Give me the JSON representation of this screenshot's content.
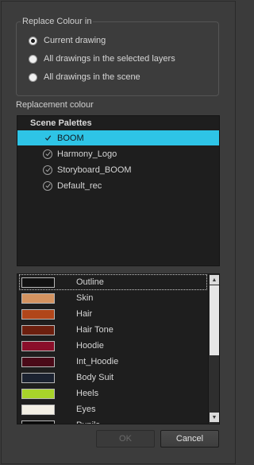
{
  "replace_group": {
    "title": "Replace Colour in",
    "options": [
      {
        "label": "Current drawing",
        "checked": true
      },
      {
        "label": "All drawings in the selected layers",
        "checked": false
      },
      {
        "label": "All drawings in the scene",
        "checked": false
      }
    ]
  },
  "replacement_label": "Replacement colour",
  "palettes": {
    "header": "Scene Palettes",
    "items": [
      {
        "label": "BOOM",
        "selected": true
      },
      {
        "label": "Harmony_Logo",
        "selected": false
      },
      {
        "label": "Storyboard_BOOM",
        "selected": false
      },
      {
        "label": "Default_rec",
        "selected": false
      }
    ]
  },
  "colours": [
    {
      "label": "Outline",
      "color": "#111111"
    },
    {
      "label": "Skin",
      "color": "#d49360"
    },
    {
      "label": "Hair",
      "color": "#b1461a"
    },
    {
      "label": "Hair Tone",
      "color": "#6c1f0e"
    },
    {
      "label": "Hoodie",
      "color": "#8a0f2a"
    },
    {
      "label": "Int_Hoodie",
      "color": "#4a0a18"
    },
    {
      "label": "Body Suit",
      "color": "#1b2230"
    },
    {
      "label": "Heels",
      "color": "#a8d42a"
    },
    {
      "label": "Eyes",
      "color": "#f3efe4"
    },
    {
      "label": "Pupils",
      "color": "#0a0a0a"
    }
  ],
  "buttons": {
    "ok": "OK",
    "cancel": "Cancel"
  },
  "colors": {
    "selection": "#2ec4e6",
    "background": "#3c3c3c"
  }
}
